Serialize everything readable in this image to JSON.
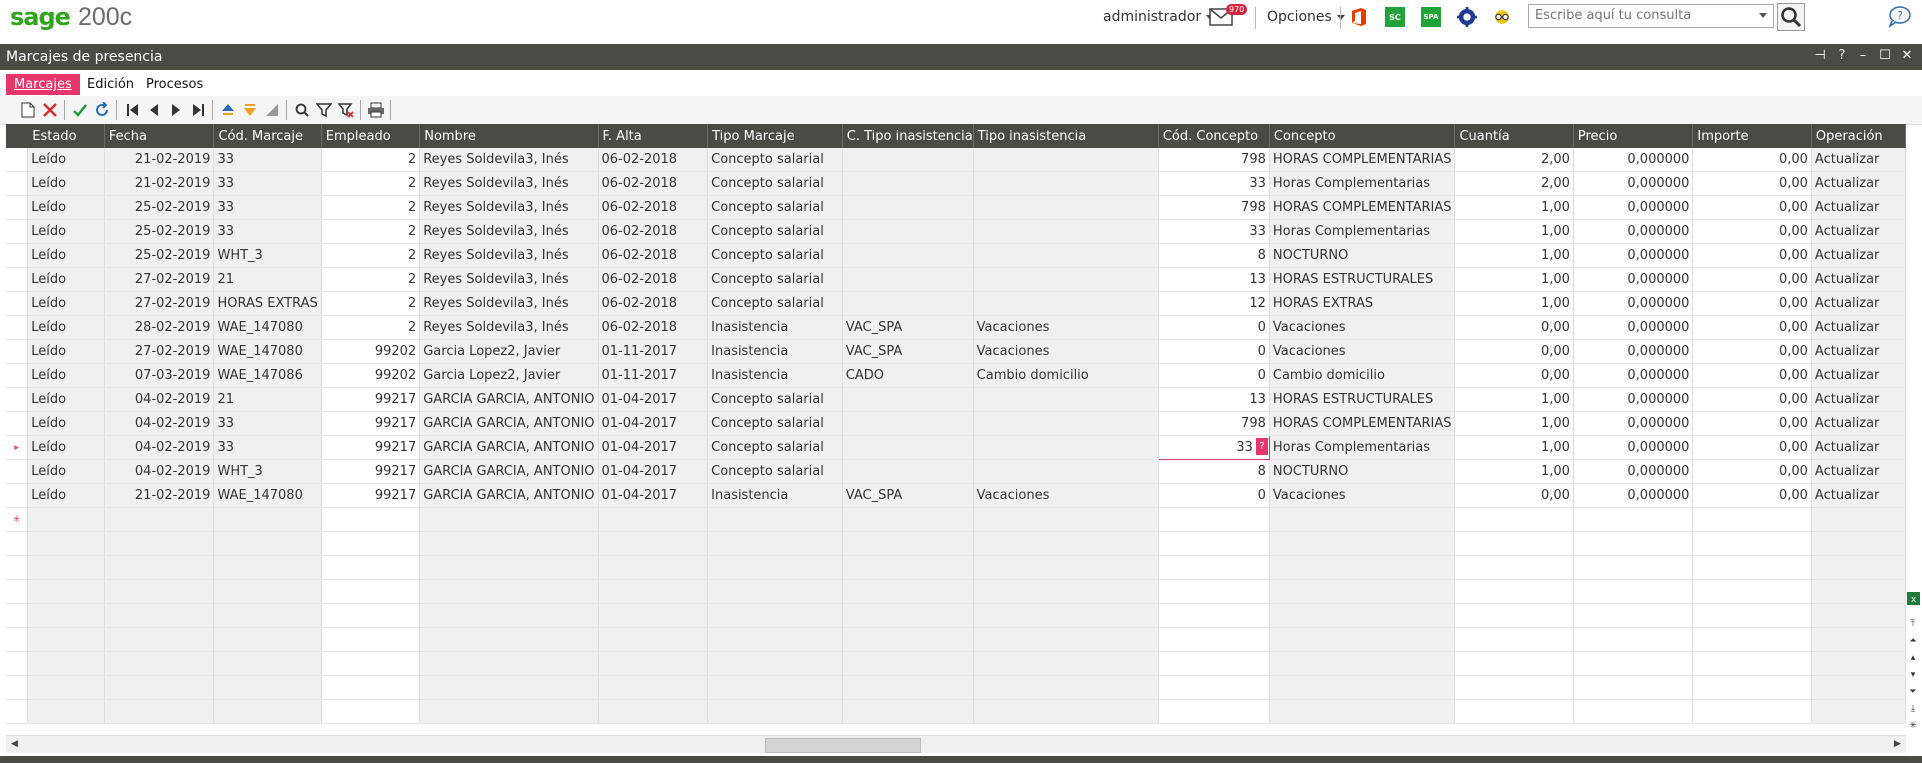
{
  "app": {
    "brand": "sage",
    "product": "200c"
  },
  "topbar": {
    "user": "administrador",
    "mail_badge": "970",
    "options_label": "Opciones",
    "sc_label": "SC",
    "spa_label": "SPA",
    "search_placeholder": "Escribe aquí tu consulta"
  },
  "window": {
    "title": "Marcajes de presencia"
  },
  "menu": {
    "marcajes": "Marcajes",
    "edicion": "Edición",
    "procesos": "Procesos"
  },
  "grid": {
    "columns": [
      "Estado",
      "Fecha",
      "Cód. Marcaje",
      "Empleado",
      "Nombre",
      "F. Alta",
      "Tipo Marcaje",
      "C. Tipo inasistencia",
      "Tipo inasistencia",
      "Cód. Concepto",
      "Concepto",
      "Cuantía",
      "Precio",
      "Importe",
      "Operación"
    ],
    "rows": [
      [
        "Leído",
        "21-02-2019",
        "33",
        "2",
        "Reyes Soldevila3, Inés",
        "06-02-2018",
        "Concepto salarial",
        "",
        "",
        "798",
        "HORAS COMPLEMENTARIAS",
        "2,00",
        "0,000000",
        "0,00",
        "Actualizar"
      ],
      [
        "Leído",
        "21-02-2019",
        "33",
        "2",
        "Reyes Soldevila3, Inés",
        "06-02-2018",
        "Concepto salarial",
        "",
        "",
        "33",
        "Horas Complementarias",
        "2,00",
        "0,000000",
        "0,00",
        "Actualizar"
      ],
      [
        "Leído",
        "25-02-2019",
        "33",
        "2",
        "Reyes Soldevila3, Inés",
        "06-02-2018",
        "Concepto salarial",
        "",
        "",
        "798",
        "HORAS COMPLEMENTARIAS",
        "1,00",
        "0,000000",
        "0,00",
        "Actualizar"
      ],
      [
        "Leído",
        "25-02-2019",
        "33",
        "2",
        "Reyes Soldevila3, Inés",
        "06-02-2018",
        "Concepto salarial",
        "",
        "",
        "33",
        "Horas Complementarias",
        "1,00",
        "0,000000",
        "0,00",
        "Actualizar"
      ],
      [
        "Leído",
        "25-02-2019",
        "WHT_3",
        "2",
        "Reyes Soldevila3, Inés",
        "06-02-2018",
        "Concepto salarial",
        "",
        "",
        "8",
        "NOCTURNO",
        "1,00",
        "0,000000",
        "0,00",
        "Actualizar"
      ],
      [
        "Leído",
        "27-02-2019",
        "21",
        "2",
        "Reyes Soldevila3, Inés",
        "06-02-2018",
        "Concepto salarial",
        "",
        "",
        "13",
        "HORAS ESTRUCTURALES",
        "1,00",
        "0,000000",
        "0,00",
        "Actualizar"
      ],
      [
        "Leído",
        "27-02-2019",
        "HORAS EXTRAS",
        "2",
        "Reyes Soldevila3, Inés",
        "06-02-2018",
        "Concepto salarial",
        "",
        "",
        "12",
        "HORAS EXTRAS",
        "1,00",
        "0,000000",
        "0,00",
        "Actualizar"
      ],
      [
        "Leído",
        "28-02-2019",
        "WAE_147080",
        "2",
        "Reyes Soldevila3, Inés",
        "06-02-2018",
        "Inasistencia",
        "VAC_SPA",
        "Vacaciones",
        "0",
        "Vacaciones",
        "0,00",
        "0,000000",
        "0,00",
        "Actualizar"
      ],
      [
        "Leído",
        "27-02-2019",
        "WAE_147080",
        "99202",
        "Garcia Lopez2, Javier",
        "01-11-2017",
        "Inasistencia",
        "VAC_SPA",
        "Vacaciones",
        "0",
        "Vacaciones",
        "0,00",
        "0,000000",
        "0,00",
        "Actualizar"
      ],
      [
        "Leído",
        "07-03-2019",
        "WAE_147086",
        "99202",
        "Garcia Lopez2, Javier",
        "01-11-2017",
        "Inasistencia",
        "CADO",
        "Cambio domicilio",
        "0",
        "Cambio domicilio",
        "0,00",
        "0,000000",
        "0,00",
        "Actualizar"
      ],
      [
        "Leído",
        "04-02-2019",
        "21",
        "99217",
        "GARCIA GARCIA, ANTONIO",
        "01-04-2017",
        "Concepto salarial",
        "",
        "",
        "13",
        "HORAS ESTRUCTURALES",
        "1,00",
        "0,000000",
        "0,00",
        "Actualizar"
      ],
      [
        "Leído",
        "04-02-2019",
        "33",
        "99217",
        "GARCIA GARCIA, ANTONIO",
        "01-04-2017",
        "Concepto salarial",
        "",
        "",
        "798",
        "HORAS COMPLEMENTARIAS",
        "1,00",
        "0,000000",
        "0,00",
        "Actualizar"
      ],
      [
        "Leído",
        "04-02-2019",
        "33",
        "99217",
        "GARCIA GARCIA, ANTONIO",
        "01-04-2017",
        "Concepto salarial",
        "",
        "",
        "33",
        "Horas Complementarias",
        "1,00",
        "0,000000",
        "0,00",
        "Actualizar"
      ],
      [
        "Leído",
        "04-02-2019",
        "WHT_3",
        "99217",
        "GARCIA GARCIA, ANTONIO",
        "01-04-2017",
        "Concepto salarial",
        "",
        "",
        "8",
        "NOCTURNO",
        "1,00",
        "0,000000",
        "0,00",
        "Actualizar"
      ],
      [
        "Leído",
        "21-02-2019",
        "WAE_147080",
        "99217",
        "GARCIA GARCIA, ANTONIO",
        "01-04-2017",
        "Inasistencia",
        "VAC_SPA",
        "Vacaciones",
        "0",
        "Vacaciones",
        "0,00",
        "0,000000",
        "0,00",
        "Actualizar"
      ]
    ],
    "current_row": 12,
    "editing_col": 9,
    "edit_button_label": "?"
  },
  "colors": {
    "accent": "#e8356a",
    "header": "#4b4b45",
    "brand_green": "#2fa51a"
  }
}
